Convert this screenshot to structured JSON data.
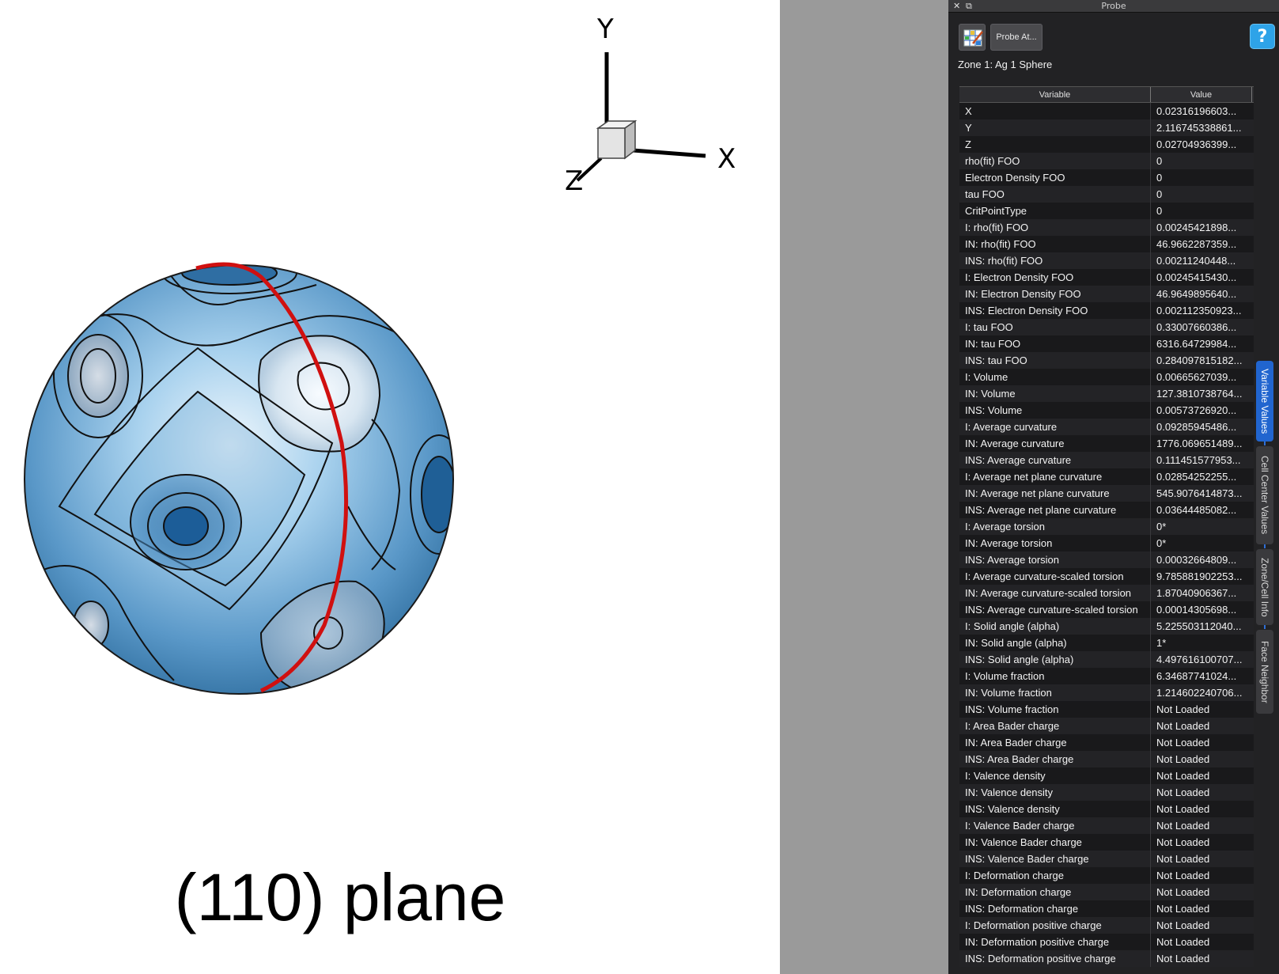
{
  "viewport": {
    "axes": {
      "y": "Y",
      "x": "X",
      "z": "Z"
    },
    "plane_label": "(110) plane"
  },
  "probe": {
    "window_title": "Probe",
    "close_glyph": "✕",
    "restore_glyph": "⧉",
    "probe_at_label": "Probe At...",
    "help_label": "?",
    "zone_label": "Zone 1: Ag 1 Sphere",
    "columns": {
      "variable": "Variable",
      "value": "Value"
    },
    "rows": [
      {
        "variable": "X",
        "value": "0.02316196603..."
      },
      {
        "variable": "Y",
        "value": "2.116745338861..."
      },
      {
        "variable": "Z",
        "value": "0.02704936399..."
      },
      {
        "variable": "rho(fit) FOO",
        "value": "0"
      },
      {
        "variable": "Electron Density FOO",
        "value": "0"
      },
      {
        "variable": "tau FOO",
        "value": "0"
      },
      {
        "variable": "CritPointType",
        "value": "0"
      },
      {
        "variable": "I: rho(fit) FOO",
        "value": "0.00245421898..."
      },
      {
        "variable": "IN: rho(fit) FOO",
        "value": "46.9662287359..."
      },
      {
        "variable": "INS: rho(fit) FOO",
        "value": "0.00211240448..."
      },
      {
        "variable": "I: Electron Density FOO",
        "value": "0.00245415430..."
      },
      {
        "variable": "IN: Electron Density FOO",
        "value": "46.9649895640..."
      },
      {
        "variable": "INS: Electron Density FOO",
        "value": "0.002112350923..."
      },
      {
        "variable": "I: tau FOO",
        "value": "0.33007660386..."
      },
      {
        "variable": "IN: tau FOO",
        "value": "6316.64729984..."
      },
      {
        "variable": "INS: tau FOO",
        "value": "0.284097815182..."
      },
      {
        "variable": "I: Volume",
        "value": "0.00665627039..."
      },
      {
        "variable": "IN: Volume",
        "value": "127.3810738764..."
      },
      {
        "variable": "INS: Volume",
        "value": "0.00573726920..."
      },
      {
        "variable": "I: Average curvature",
        "value": "0.09285945486..."
      },
      {
        "variable": "IN: Average curvature",
        "value": "1776.069651489..."
      },
      {
        "variable": "INS: Average curvature",
        "value": "0.111451577953..."
      },
      {
        "variable": "I: Average net plane curvature",
        "value": "0.02854252255..."
      },
      {
        "variable": "IN: Average net plane curvature",
        "value": "545.9076414873..."
      },
      {
        "variable": "INS: Average net plane curvature",
        "value": "0.03644485082..."
      },
      {
        "variable": "I: Average torsion",
        "value": "0*"
      },
      {
        "variable": "IN: Average torsion",
        "value": "0*"
      },
      {
        "variable": "INS: Average torsion",
        "value": "0.00032664809..."
      },
      {
        "variable": "I: Average curvature-scaled torsion",
        "value": "9.785881902253..."
      },
      {
        "variable": "IN: Average curvature-scaled torsion",
        "value": "1.87040906367..."
      },
      {
        "variable": "INS: Average curvature-scaled torsion",
        "value": "0.00014305698..."
      },
      {
        "variable": "I: Solid angle (alpha)",
        "value": "5.225503112040..."
      },
      {
        "variable": "IN: Solid angle (alpha)",
        "value": "1*"
      },
      {
        "variable": "INS: Solid angle (alpha)",
        "value": "4.497616100707..."
      },
      {
        "variable": "I: Volume fraction",
        "value": "6.34687741024..."
      },
      {
        "variable": "IN: Volume fraction",
        "value": "1.214602240706..."
      },
      {
        "variable": "INS: Volume fraction",
        "value": "Not Loaded"
      },
      {
        "variable": "I: Area Bader charge",
        "value": "Not Loaded"
      },
      {
        "variable": "IN: Area Bader charge",
        "value": "Not Loaded"
      },
      {
        "variable": "INS: Area Bader charge",
        "value": "Not Loaded"
      },
      {
        "variable": "I: Valence density",
        "value": "Not Loaded"
      },
      {
        "variable": "IN: Valence density",
        "value": "Not Loaded"
      },
      {
        "variable": "INS: Valence density",
        "value": "Not Loaded"
      },
      {
        "variable": "I: Valence Bader charge",
        "value": "Not Loaded"
      },
      {
        "variable": "IN: Valence Bader charge",
        "value": "Not Loaded"
      },
      {
        "variable": "INS: Valence Bader charge",
        "value": "Not Loaded"
      },
      {
        "variable": "I: Deformation charge",
        "value": "Not Loaded"
      },
      {
        "variable": "IN: Deformation charge",
        "value": "Not Loaded"
      },
      {
        "variable": "INS: Deformation charge",
        "value": "Not Loaded"
      },
      {
        "variable": "I: Deformation positive charge",
        "value": "Not Loaded"
      },
      {
        "variable": "IN: Deformation positive charge",
        "value": "Not Loaded"
      },
      {
        "variable": "INS: Deformation positive charge",
        "value": "Not Loaded"
      }
    ],
    "side_tabs": [
      {
        "label": "Variable Values",
        "active": true
      },
      {
        "label": "Cell Center Values",
        "active": false
      },
      {
        "label": "Zone/Cell Info",
        "active": false
      },
      {
        "label": "Face Neighbor",
        "active": false
      }
    ]
  },
  "colors": {
    "sphere_highlight": "#e6f1fa",
    "sphere_mid": "#8fc3e6",
    "sphere_dark": "#1f5f96",
    "red_curve": "#d01010",
    "panel_bg": "#222224",
    "gray_gap": "#9a9a9a",
    "active_tab": "#2165cf",
    "help_button": "#2ea3e8"
  }
}
